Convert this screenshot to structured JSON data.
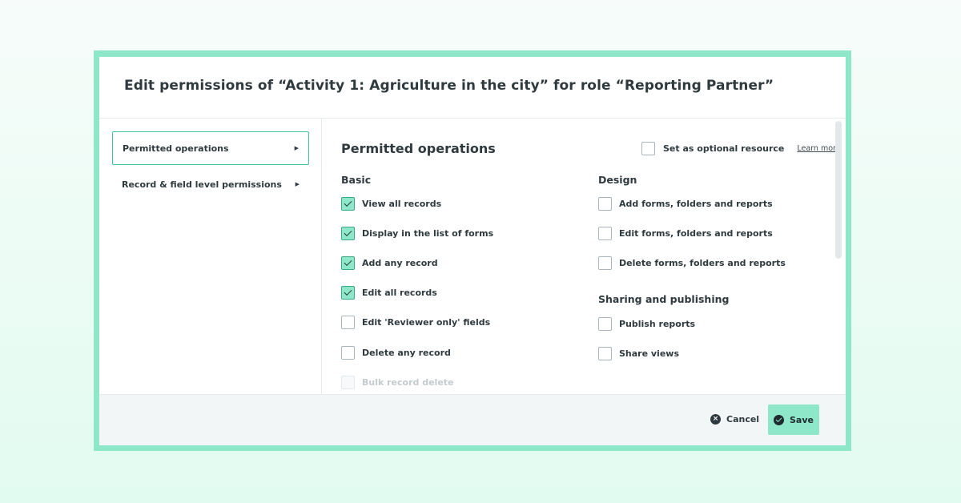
{
  "dialog": {
    "title": "Edit permissions of “Activity 1: Agriculture in the city” for role “Reporting Partner”"
  },
  "sidebar": {
    "items": [
      {
        "label": "Permitted operations",
        "active": true
      },
      {
        "label": "Record & field level permissions",
        "active": false
      }
    ]
  },
  "content": {
    "title": "Permitted operations",
    "optional_label": "Set as optional resource",
    "optional_checked": false,
    "learn_more": "Learn more",
    "basic": {
      "title": "Basic",
      "options": [
        {
          "label": "View all records",
          "checked": true
        },
        {
          "label": "Display in the list of forms",
          "checked": true
        },
        {
          "label": "Add any record",
          "checked": true
        },
        {
          "label": "Edit all records",
          "checked": true
        },
        {
          "label": "Edit 'Reviewer only' fields",
          "checked": false
        },
        {
          "label": "Delete any record",
          "checked": false
        },
        {
          "label": "Bulk record delete",
          "checked": false,
          "disabled": true
        }
      ]
    },
    "design": {
      "title": "Design",
      "options": [
        {
          "label": "Add forms, folders and reports",
          "checked": false
        },
        {
          "label": "Edit forms, folders and reports",
          "checked": false
        },
        {
          "label": "Delete forms, folders and reports",
          "checked": false
        }
      ]
    },
    "sharing": {
      "title": "Sharing and publishing",
      "options": [
        {
          "label": "Publish reports",
          "checked": false
        },
        {
          "label": "Share views",
          "checked": false
        }
      ]
    }
  },
  "footer": {
    "cancel_label": "Cancel",
    "save_label": "Save"
  },
  "colors": {
    "accent": "#8ee7c8",
    "accent_border": "#3fc59a",
    "text": "#2f3a3f"
  }
}
